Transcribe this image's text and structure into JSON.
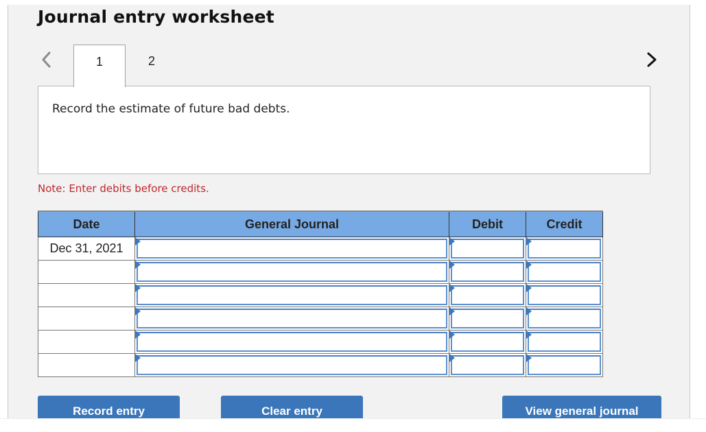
{
  "title": "Journal entry worksheet",
  "nav": {
    "prev_icon": "chevron-left-icon",
    "next_icon": "chevron-right-icon"
  },
  "tabs": [
    {
      "label": "1",
      "active": true
    },
    {
      "label": "2",
      "active": false
    }
  ],
  "description": "Record the estimate of future bad debts.",
  "note": "Note: Enter debits before credits.",
  "table": {
    "headers": [
      "Date",
      "General Journal",
      "Debit",
      "Credit"
    ],
    "rows": [
      {
        "date": "Dec 31, 2021",
        "account": "",
        "debit": "",
        "credit": ""
      },
      {
        "date": "",
        "account": "",
        "debit": "",
        "credit": ""
      },
      {
        "date": "",
        "account": "",
        "debit": "",
        "credit": ""
      },
      {
        "date": "",
        "account": "",
        "debit": "",
        "credit": ""
      },
      {
        "date": "",
        "account": "",
        "debit": "",
        "credit": ""
      },
      {
        "date": "",
        "account": "",
        "debit": "",
        "credit": ""
      }
    ]
  },
  "buttons": {
    "record": "Record entry",
    "clear": "Clear entry",
    "view": "View general journal"
  },
  "colors": {
    "header_bg": "#77aae4",
    "button_bg": "#3a76b9",
    "note_text": "#c0272d",
    "input_border": "#5b8fd0"
  }
}
